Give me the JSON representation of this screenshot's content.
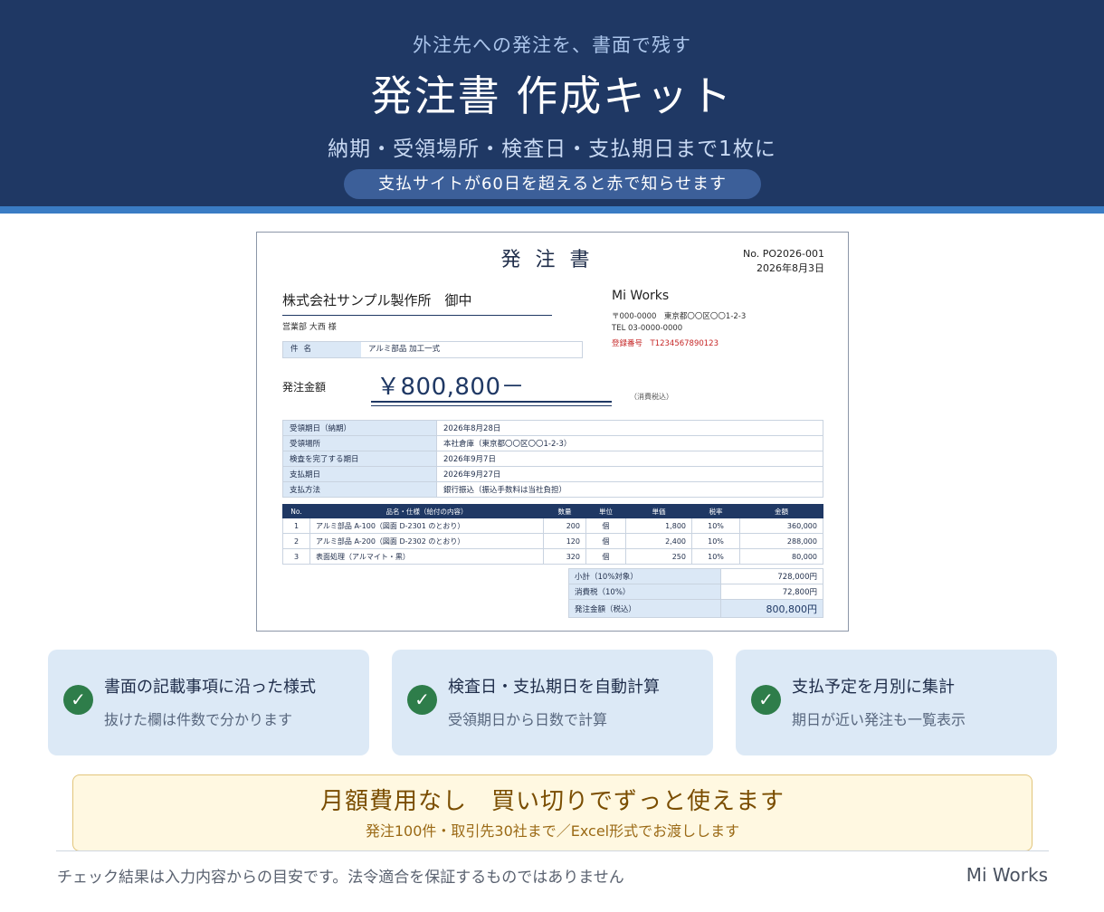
{
  "hero": {
    "kicker": "外注先への発注を、書面で残す",
    "title": "発注書 作成キット",
    "subtitle": "納期・受領場所・検査日・支払期日まで1枚に",
    "pill": "支払サイトが60日を超えると赤で知らせます"
  },
  "document": {
    "title": "発注書",
    "number": "No.  PO2026-001",
    "date": "2026年8月3日",
    "vendor": "株式会社サンプル製作所　御中",
    "vendor_dept": "営業部 大西 様",
    "issuer": {
      "name": "Mi Works",
      "address": "〒000-0000　東京都〇〇区〇〇1-2-3",
      "tel": "TEL 03-0000-0000",
      "registration": "登録番号　T1234567890123"
    },
    "subject_label": "件名",
    "subject_value": "アルミ部品 加工一式",
    "amount_label": "発注金額",
    "amount_value": "￥800,800－",
    "amount_note": "（消費税込）",
    "info": [
      {
        "key": "受領期日（納期）",
        "value": "2026年8月28日"
      },
      {
        "key": "受領場所",
        "value": "本社倉庫（東京都〇〇区〇〇1-2-3）"
      },
      {
        "key": "検査を完了する期日",
        "value": "2026年9月7日"
      },
      {
        "key": "支払期日",
        "value": "2026年9月27日"
      },
      {
        "key": "支払方法",
        "value": "銀行振込（振込手数料は当社負担）"
      }
    ],
    "item_headers": [
      "No.",
      "品名・仕様（給付の内容）",
      "数量",
      "単位",
      "単価",
      "税率",
      "金額"
    ],
    "items": [
      {
        "no": "1",
        "name": "アルミ部品 A-100（図面 D-2301 のとおり）",
        "qty": "200",
        "unit": "個",
        "price": "1,800",
        "tax": "10%",
        "amount": "360,000"
      },
      {
        "no": "2",
        "name": "アルミ部品 A-200（図面 D-2302 のとおり）",
        "qty": "120",
        "unit": "個",
        "price": "2,400",
        "tax": "10%",
        "amount": "288,000"
      },
      {
        "no": "3",
        "name": "表面処理（アルマイト・黒）",
        "qty": "320",
        "unit": "個",
        "price": "250",
        "tax": "10%",
        "amount": "80,000"
      }
    ],
    "totals": [
      {
        "key": "小計（10%対象）",
        "value": "728,000円"
      },
      {
        "key": "消費税（10%）",
        "value": "72,800円"
      },
      {
        "key": "発注金額（税込）",
        "value": "800,800円"
      }
    ]
  },
  "features": [
    {
      "title": "書面の記載事項に沿った様式",
      "desc": "抜けた欄は件数で分かります"
    },
    {
      "title": "検査日・支払期日を自動計算",
      "desc": "受領期日から日数で計算"
    },
    {
      "title": "支払予定を月別に集計",
      "desc": "期日が近い発注も一覧表示"
    }
  ],
  "promo": {
    "title": "月額費用なし　買い切りでずっと使えます",
    "subtitle": "発注100件・取引先30社まで／Excel形式でお渡しします"
  },
  "footer": {
    "disclaimer": "チェック結果は入力内容からの目安です。法令適合を保証するものではありません",
    "brand": "Mi Works"
  },
  "colors": {
    "navy": "#1f3864",
    "accent_blue": "#3a7cc4",
    "check_green": "#2e7d4a",
    "warning_red": "#c62828"
  }
}
